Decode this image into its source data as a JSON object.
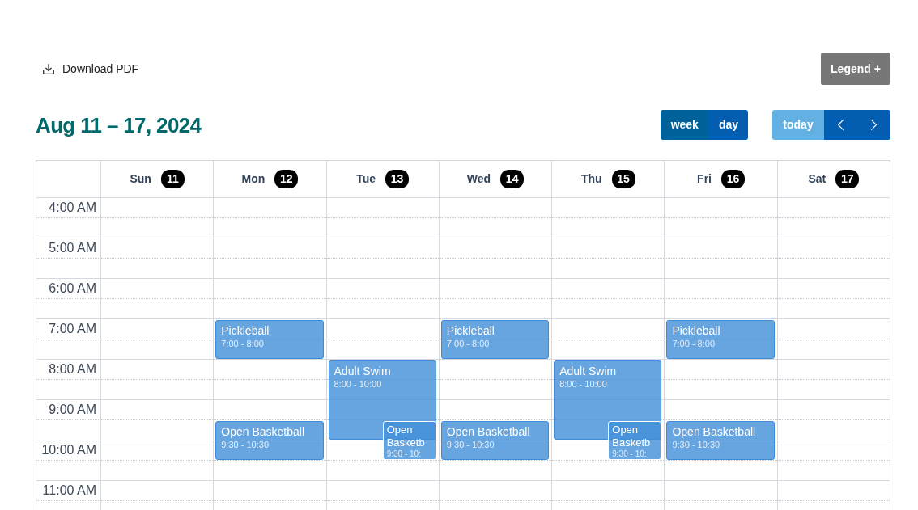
{
  "toolbar": {
    "download_link": {
      "label": "Download PDF"
    },
    "legend_button": {
      "label": "Legend +"
    }
  },
  "header": {
    "title": "Aug 11 – 17, 2024",
    "view_buttons": [
      {
        "label": "week",
        "selected": true
      },
      {
        "label": "day",
        "selected": false
      }
    ],
    "today_button": {
      "label": "today",
      "disabled": true
    },
    "nav_buttons": [
      {
        "kind": "prev"
      },
      {
        "kind": "next"
      }
    ]
  },
  "calendar": {
    "time_slots": [
      "4:00 AM",
      "5:00 AM",
      "6:00 AM",
      "7:00 AM",
      "8:00 AM",
      "9:00 AM",
      "10:00 AM",
      "11:00 AM"
    ],
    "days": [
      {
        "name": "Sun",
        "date": "11"
      },
      {
        "name": "Mon",
        "date": "12",
        "events": [
          {
            "title": "Pickleball",
            "time": "7:00 - 8:00"
          },
          {
            "title": "Open Basketball",
            "time": "9:30 - 10:30"
          }
        ]
      },
      {
        "name": "Tue",
        "date": "13",
        "events": [
          {
            "title": "Adult Swim",
            "time": "8:00 - 10:00"
          },
          {
            "title": "Open Basketb",
            "time": "9:30 - 10:"
          }
        ]
      },
      {
        "name": "Wed",
        "date": "14",
        "events": [
          {
            "title": "Pickleball",
            "time": "7:00 - 8:00"
          },
          {
            "title": "Open Basketball",
            "time": "9:30 - 10:30"
          }
        ]
      },
      {
        "name": "Thu",
        "date": "15",
        "events": [
          {
            "title": "Adult Swim",
            "time": "8:00 - 10:00"
          },
          {
            "title": "Open Basketb",
            "time": "9:30 - 10:"
          }
        ]
      },
      {
        "name": "Fri",
        "date": "16",
        "events": [
          {
            "title": "Pickleball",
            "time": "7:00 - 8:00"
          },
          {
            "title": "Open Basketball",
            "time": "9:30 - 10:30"
          }
        ]
      },
      {
        "name": "Sat",
        "date": "17"
      }
    ]
  }
}
